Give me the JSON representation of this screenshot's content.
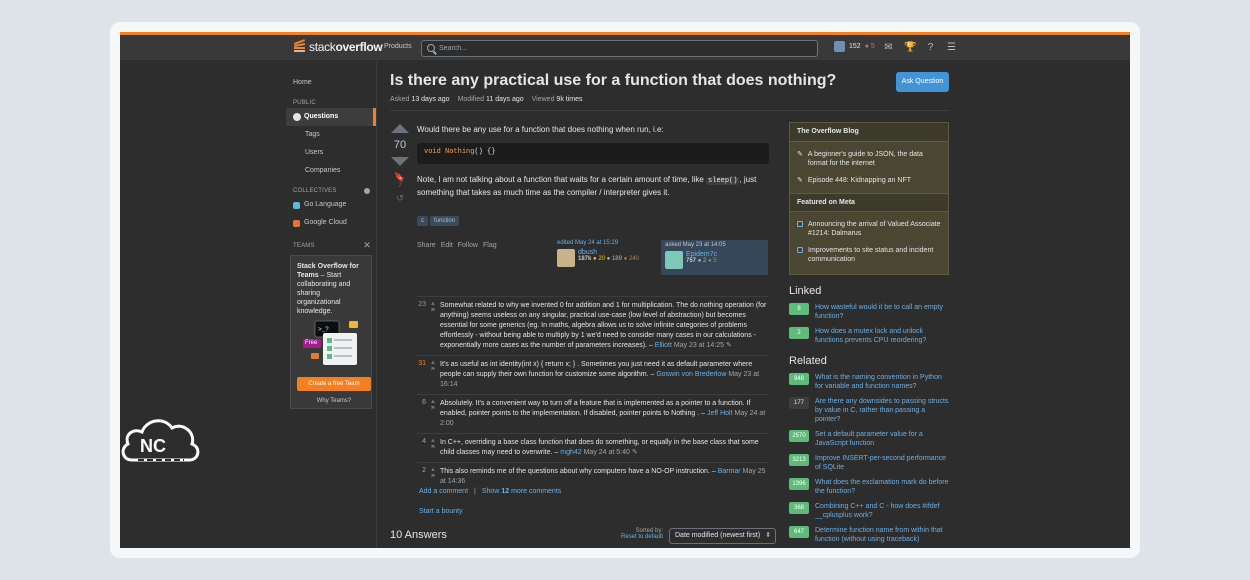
{
  "topbar": {
    "logo_prefix": "stack",
    "logo_bold": "overflow",
    "products": "Products",
    "search_placeholder": "Search...",
    "reputation": "152",
    "bronze_badges": "● 5"
  },
  "sidebar": {
    "home": "Home",
    "public_label": "PUBLIC",
    "questions": "Questions",
    "tags": "Tags",
    "users": "Users",
    "companies": "Companies",
    "collectives_label": "COLLECTIVES",
    "collectives": [
      {
        "label": "Go Language",
        "color": "#61b7d8"
      },
      {
        "label": "Google Cloud",
        "color": "#e8733a"
      }
    ],
    "teams_label": "TEAMS",
    "teams_title": "Stack Overflow for Teams",
    "teams_desc": " – Start collaborating and sharing organizational knowledge.",
    "teams_cta": "Create a free Team",
    "teams_why": "Why Teams?",
    "free_badge": "Free"
  },
  "question": {
    "title": "Is there any practical use for a function that does nothing?",
    "asked_label": "Asked",
    "asked_value": "13 days ago",
    "modified_label": "Modified",
    "modified_value": "11 days ago",
    "viewed_label": "Viewed",
    "viewed_value": "9k times",
    "ask_button": "Ask Question",
    "votes": "70",
    "bookmarks": "7",
    "body_1": "Would there be any use for a function that does nothing when run, i.e:",
    "code_kw": "void",
    "code_fn": " Nothing",
    "code_rest": "() {}",
    "body_2a": "Note, I am not talking about a function that waits for a certain amount of time, like ",
    "body_2_code": "sleep()",
    "body_2b": ", just something that takes as much time as the compiler / interpreter gives it.",
    "tags": [
      "c",
      "function"
    ],
    "actions": [
      "Share",
      "Edit",
      "Follow",
      "Flag"
    ],
    "edited_label": "edited May 24 at 15:29",
    "editor_name": "dbush",
    "editor_rep": "187k",
    "editor_gold": "● 20",
    "editor_silver": "● 189",
    "editor_bronze": "● 240",
    "asked_card_label": "asked May 23 at 14:05",
    "asker_name": "Epidem7c",
    "asker_rep": "757",
    "asker_silver": "● 2",
    "asker_bronze": "● 5"
  },
  "comments": [
    {
      "score": "23",
      "hot": true,
      "text": "Somewhat related to why we invented 0 for addition and 1 for multiplication. The do nothing operation (for anything) seems useless on any singular, practical use-case (low level of abstraction) but becomes essential for some generics (eg. In maths, algebra allows us to solve infinite categories of problems effortlessly - without being able to multiply by 1 we'd need to consider many cases in our calculations - exponentially more cases as the number of parameters increases). –",
      "user": "Elliott",
      "date": "May 23 at 14:25 ✎"
    },
    {
      "score": "31",
      "hot": true,
      "text": "It's as useful as int identity(int x) { return x; } . Sometimes you just need it as default parameter where people can supply their own function for customize some algorithm. –",
      "user": "Goswin von Brederlow",
      "date": "May 23 at 16:14"
    },
    {
      "score": "6",
      "hot": false,
      "text": "Absolutely. It's a convenient way to turn off a feature that is implemented as a pointer to a function. If enabled, pointer points to the implementation. If disabled, pointer points to Nothing . –",
      "user": "Jeff Holt",
      "date": "May 24 at 2:00"
    },
    {
      "score": "4",
      "hot": false,
      "text": "In C++, overriding a base class function that does do something, or equally in the base class that some child classes may need to overwrite. –",
      "user": "mgh42",
      "date": "May 24 at 5:40 ✎"
    },
    {
      "score": "2",
      "hot": false,
      "text": "This also reminds me of the questions about why computers have a NO-OP instruction. –",
      "user": "Barmar",
      "date": "May 25 at 14:36"
    }
  ],
  "comment_footer": {
    "add": "Add a comment",
    "sep": "|",
    "show_prefix": "Show",
    "show_count": "12",
    "show_suffix": "more comments",
    "bounty": "Start a bounty"
  },
  "answers": {
    "count_label": "10 Answers",
    "sorted_by": "Sorted by:",
    "reset": "Reset to default",
    "sort_value": "Date modified (newest first)"
  },
  "rightbar": {
    "blog_title": "The Overflow Blog",
    "blog_items": [
      "A beginner's guide to JSON, the data format for the internet",
      "Episode 448: Kidnapping an NFT"
    ],
    "meta_title": "Featured on Meta",
    "meta_items": [
      "Announcing the arrival of Valued Associate #1214: Dalmarus",
      "Improvements to site status and incident communication"
    ],
    "linked_title": "Linked",
    "linked": [
      {
        "score": "8",
        "text": "How wasteful would it be to call an empty function?"
      },
      {
        "score": "2",
        "text": "How does a mutex lock and unlock functions prevents CPU reordering?"
      }
    ],
    "related_title": "Related",
    "related": [
      {
        "score": "948",
        "dark": false,
        "text": "What is the naming convention in Python for variable and function names?"
      },
      {
        "score": "177",
        "dark": true,
        "text": "Are there any downsides to passing structs by value in C, rather than passing a pointer?"
      },
      {
        "score": "2570",
        "dark": false,
        "text": "Set a default parameter value for a JavaScript function"
      },
      {
        "score": "3213",
        "dark": false,
        "text": "Improve INSERT-per-second performance of SQLite"
      },
      {
        "score": "1396",
        "dark": false,
        "text": "What does the exclamation mark do before the function?"
      },
      {
        "score": "368",
        "dark": false,
        "text": "Combining C++ and C - how does #ifdef __cplusplus work?"
      },
      {
        "score": "647",
        "dark": false,
        "text": "Determine function name from within that function (without using traceback)"
      }
    ]
  },
  "watermark": {
    "text": "NC"
  },
  "colors": {
    "accent": "#f48024",
    "link": "#6ab0e6",
    "button": "#4393d7",
    "accepted": "#5eba7d"
  }
}
